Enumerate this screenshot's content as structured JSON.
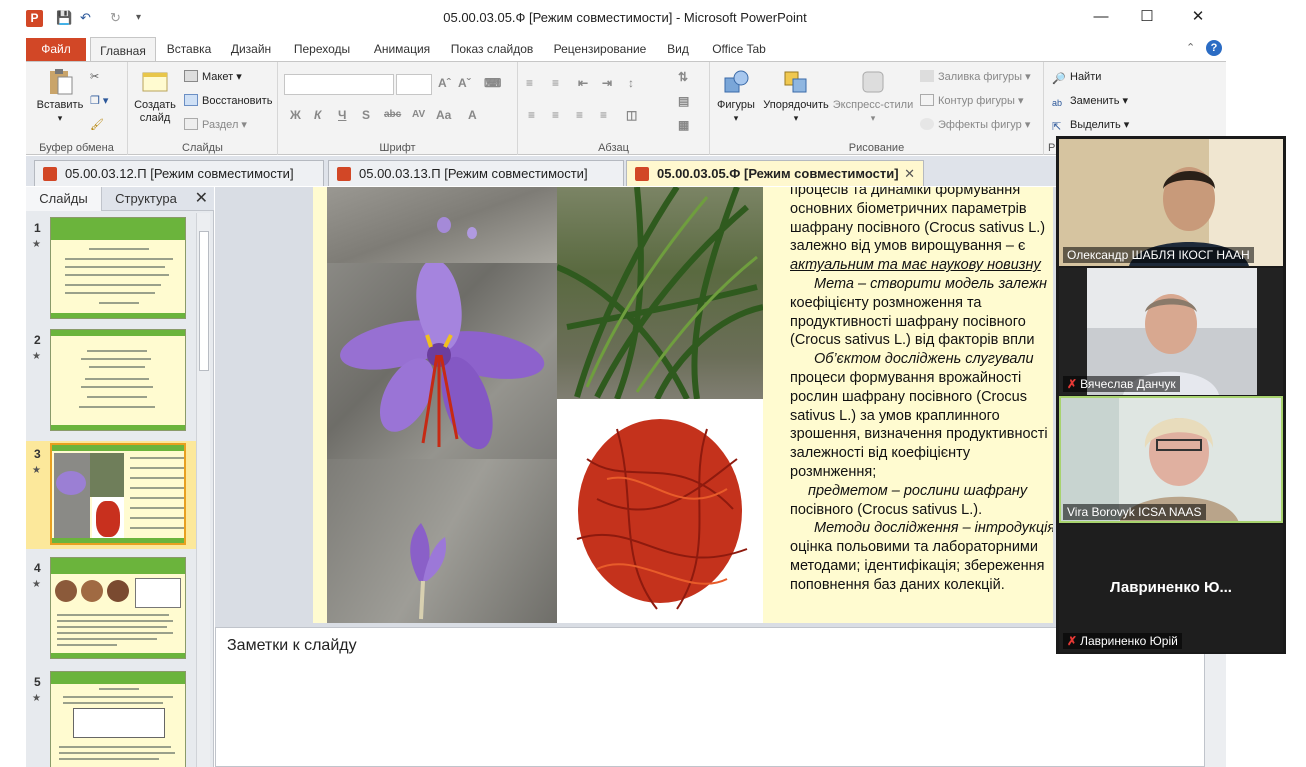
{
  "window": {
    "title": "05.00.03.05.Ф [Режим совместимости]  -  Microsoft PowerPoint",
    "minimize": "—",
    "maximize": "☐",
    "close": "✕"
  },
  "ribbon_tabs": [
    "Файл",
    "Главная",
    "Вставка",
    "Дизайн",
    "Переходы",
    "Анимация",
    "Показ слайдов",
    "Рецензирование",
    "Вид",
    "Office Tab"
  ],
  "ribbon": {
    "clipboard": {
      "paste": "Вставить",
      "label": "Буфер обмена"
    },
    "slides": {
      "create": "Создать слайд",
      "layout": "Макет",
      "reset": "Восстановить",
      "section": "Раздел",
      "label": "Слайды"
    },
    "font": {
      "label": "Шрифт"
    },
    "paragraph": {
      "label": "Абзац"
    },
    "drawing": {
      "shapes": "Фигуры",
      "arrange": "Упорядочить",
      "styles": "Экспресс-стили",
      "fill": "Заливка фигуры",
      "outline": "Контур фигуры",
      "effects": "Эффекты фигур",
      "label": "Рисование"
    },
    "editing": {
      "find": "Найти",
      "replace": "Заменить",
      "select": "Выделить",
      "label": "Р"
    }
  },
  "doc_tabs": [
    {
      "label": "05.00.03.12.П [Режим совместимости]"
    },
    {
      "label": "05.00.03.13.П [Режим совместимости]"
    },
    {
      "label": "05.00.03.05.Ф [Режим совместимости]"
    }
  ],
  "panel": {
    "tab_slides": "Слайды",
    "tab_structure": "Структура",
    "close": "✕"
  },
  "thumbnails": [
    "1",
    "2",
    "3",
    "4",
    "5"
  ],
  "slide": {
    "lines": [
      "процесів та динаміки формування",
      "основних біометричних параметрів",
      "шафрану посівного (Crocus sativus L.)",
      "залежно від умов вирощування – є",
      "актуальним та має наукову новизну",
      "Мета – створити модель залежн",
      "коефіцієнту розмноження та",
      "продуктивності шафрану посівного",
      "(Crocus sativus L.) від факторів впли",
      "Об’єктом досліджень слугували",
      "процеси формування врожайності",
      "рослин шафрану посівного (Crocus",
      "sativus L.) за умов краплинного",
      "зрошення, визначення продуктивності",
      "залежності від коефіцієнту",
      "розмнження;",
      "предметом – рослини шафрану",
      "посівного (Crocus sativus L.).",
      "Методи дослідження – інтродукція",
      "оцінка польовими та лабораторними",
      "методами; ідентифікація; збереження",
      "поповнення баз даних колекцій."
    ]
  },
  "notes": {
    "placeholder": "Заметки к слайду"
  },
  "participants": [
    {
      "name": "Олександр ШАБЛЯ ІКОСГ НААН",
      "muted": false
    },
    {
      "name": "Вячеслав Данчук",
      "muted": true
    },
    {
      "name": "Vira Borovyk ICSA NAAS",
      "muted": false
    },
    {
      "name": "Лавриненко Юрій",
      "muted": true,
      "center_label": "Лавриненко  Ю..."
    }
  ]
}
